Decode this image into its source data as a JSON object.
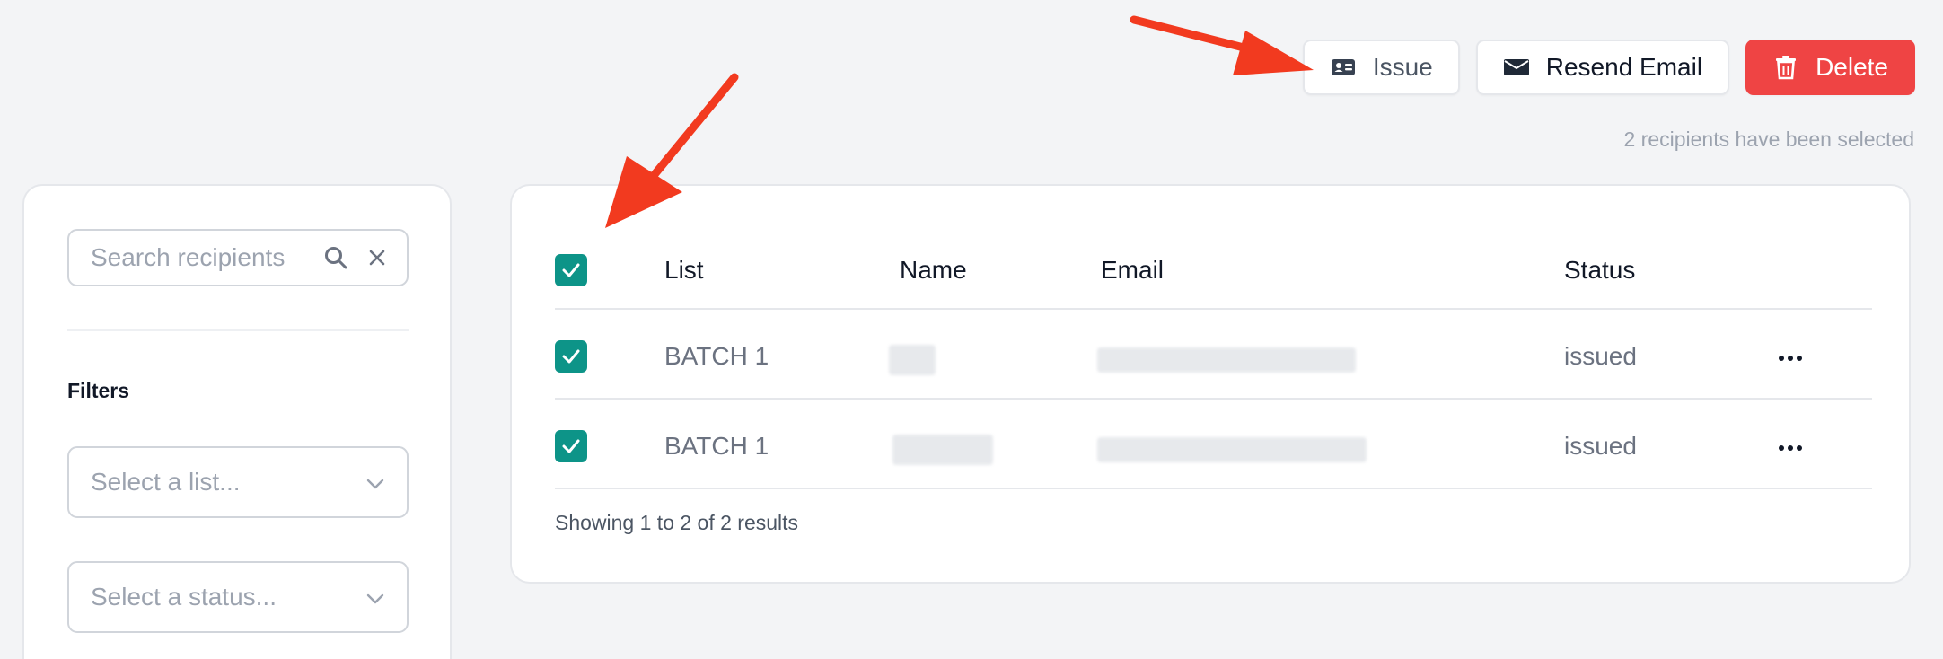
{
  "actions": {
    "issue_label": "Issue",
    "resend_label": "Resend Email",
    "delete_label": "Delete",
    "delete_color": "#ef4444"
  },
  "selection_note": "2 recipients have been selected",
  "sidebar": {
    "search_placeholder": "Search recipients",
    "filters_title": "Filters",
    "list_select_placeholder": "Select a list...",
    "status_select_placeholder": "Select a status..."
  },
  "table": {
    "columns": [
      "List",
      "Name",
      "Email",
      "Status"
    ],
    "rows": [
      {
        "list": "BATCH 1",
        "name": "",
        "email": "",
        "status": "issued",
        "selected": true
      },
      {
        "list": "BATCH 1",
        "name": "",
        "email": "",
        "status": "issued",
        "selected": true
      }
    ],
    "footer": "Showing 1 to 2 of 2 results",
    "checkbox_color": "#0d9488"
  },
  "icons": {
    "issue": "id-card-icon",
    "resend": "envelope-icon",
    "delete": "trash-icon",
    "search": "search-icon",
    "clear": "close-icon",
    "select_chevron": "chevron-down-icon",
    "row_menu": "more-horizontal-icon"
  },
  "annotation_color": "#f23a1f"
}
